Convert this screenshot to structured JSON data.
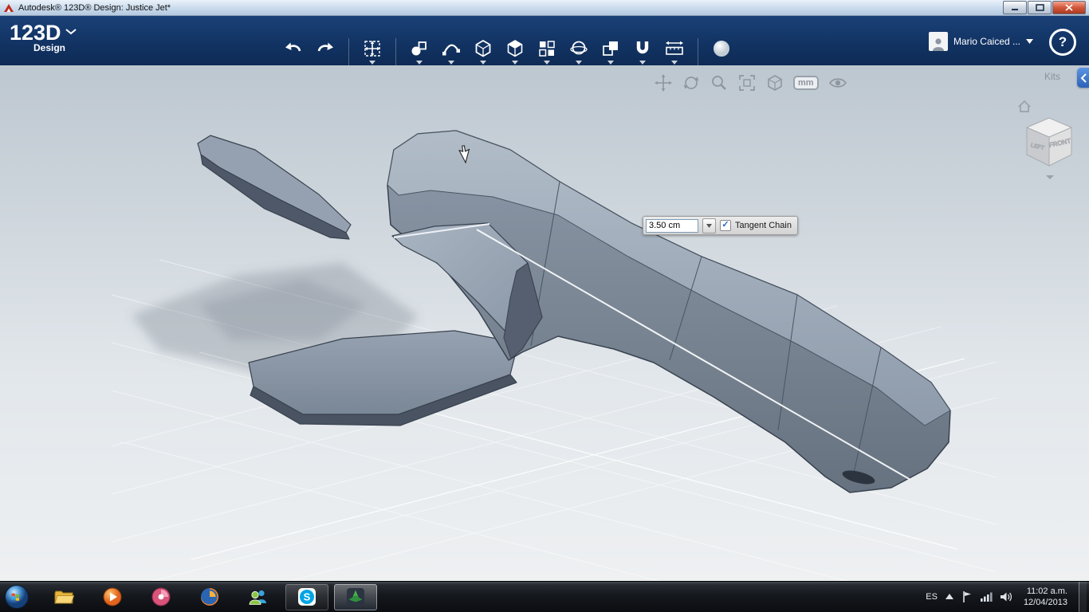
{
  "window": {
    "title": "Autodesk® 123D® Design: Justice Jet*"
  },
  "header": {
    "logo": "123D",
    "logo_sub": "Design",
    "user_name": "Mario Caiced ...",
    "help": "?",
    "tool_icons": [
      "undo",
      "redo",
      "transform-move",
      "primitives",
      "sketch",
      "chamfer",
      "extrude",
      "pattern",
      "revolve",
      "combine",
      "magnet",
      "measure",
      "material"
    ]
  },
  "viewport": {
    "kits": "Kits",
    "units": "mm",
    "controls": [
      "pan",
      "orbit",
      "zoom",
      "fit-view",
      "view-settings",
      "units-mm",
      "visibility"
    ]
  },
  "viewcube": {
    "front": "FRONT",
    "left": "LEFT"
  },
  "dialog": {
    "value": "3.50 cm",
    "checkbox": "Tangent Chain",
    "check": "✓"
  },
  "taskbar": {
    "language": "ES",
    "time": "11:02 a.m.",
    "date": "12/04/2013",
    "apps": [
      "start",
      "explorer",
      "media-player",
      "pinned-app",
      "firefox",
      "messenger",
      "skype",
      "123d-design"
    ],
    "tray_icons": [
      "hidden-icons",
      "action-center-flag",
      "network-signal",
      "volume"
    ]
  },
  "colors": {
    "header": "#12356a",
    "accent_blue": "#2c62b9",
    "model_gray": "#7c8899"
  }
}
